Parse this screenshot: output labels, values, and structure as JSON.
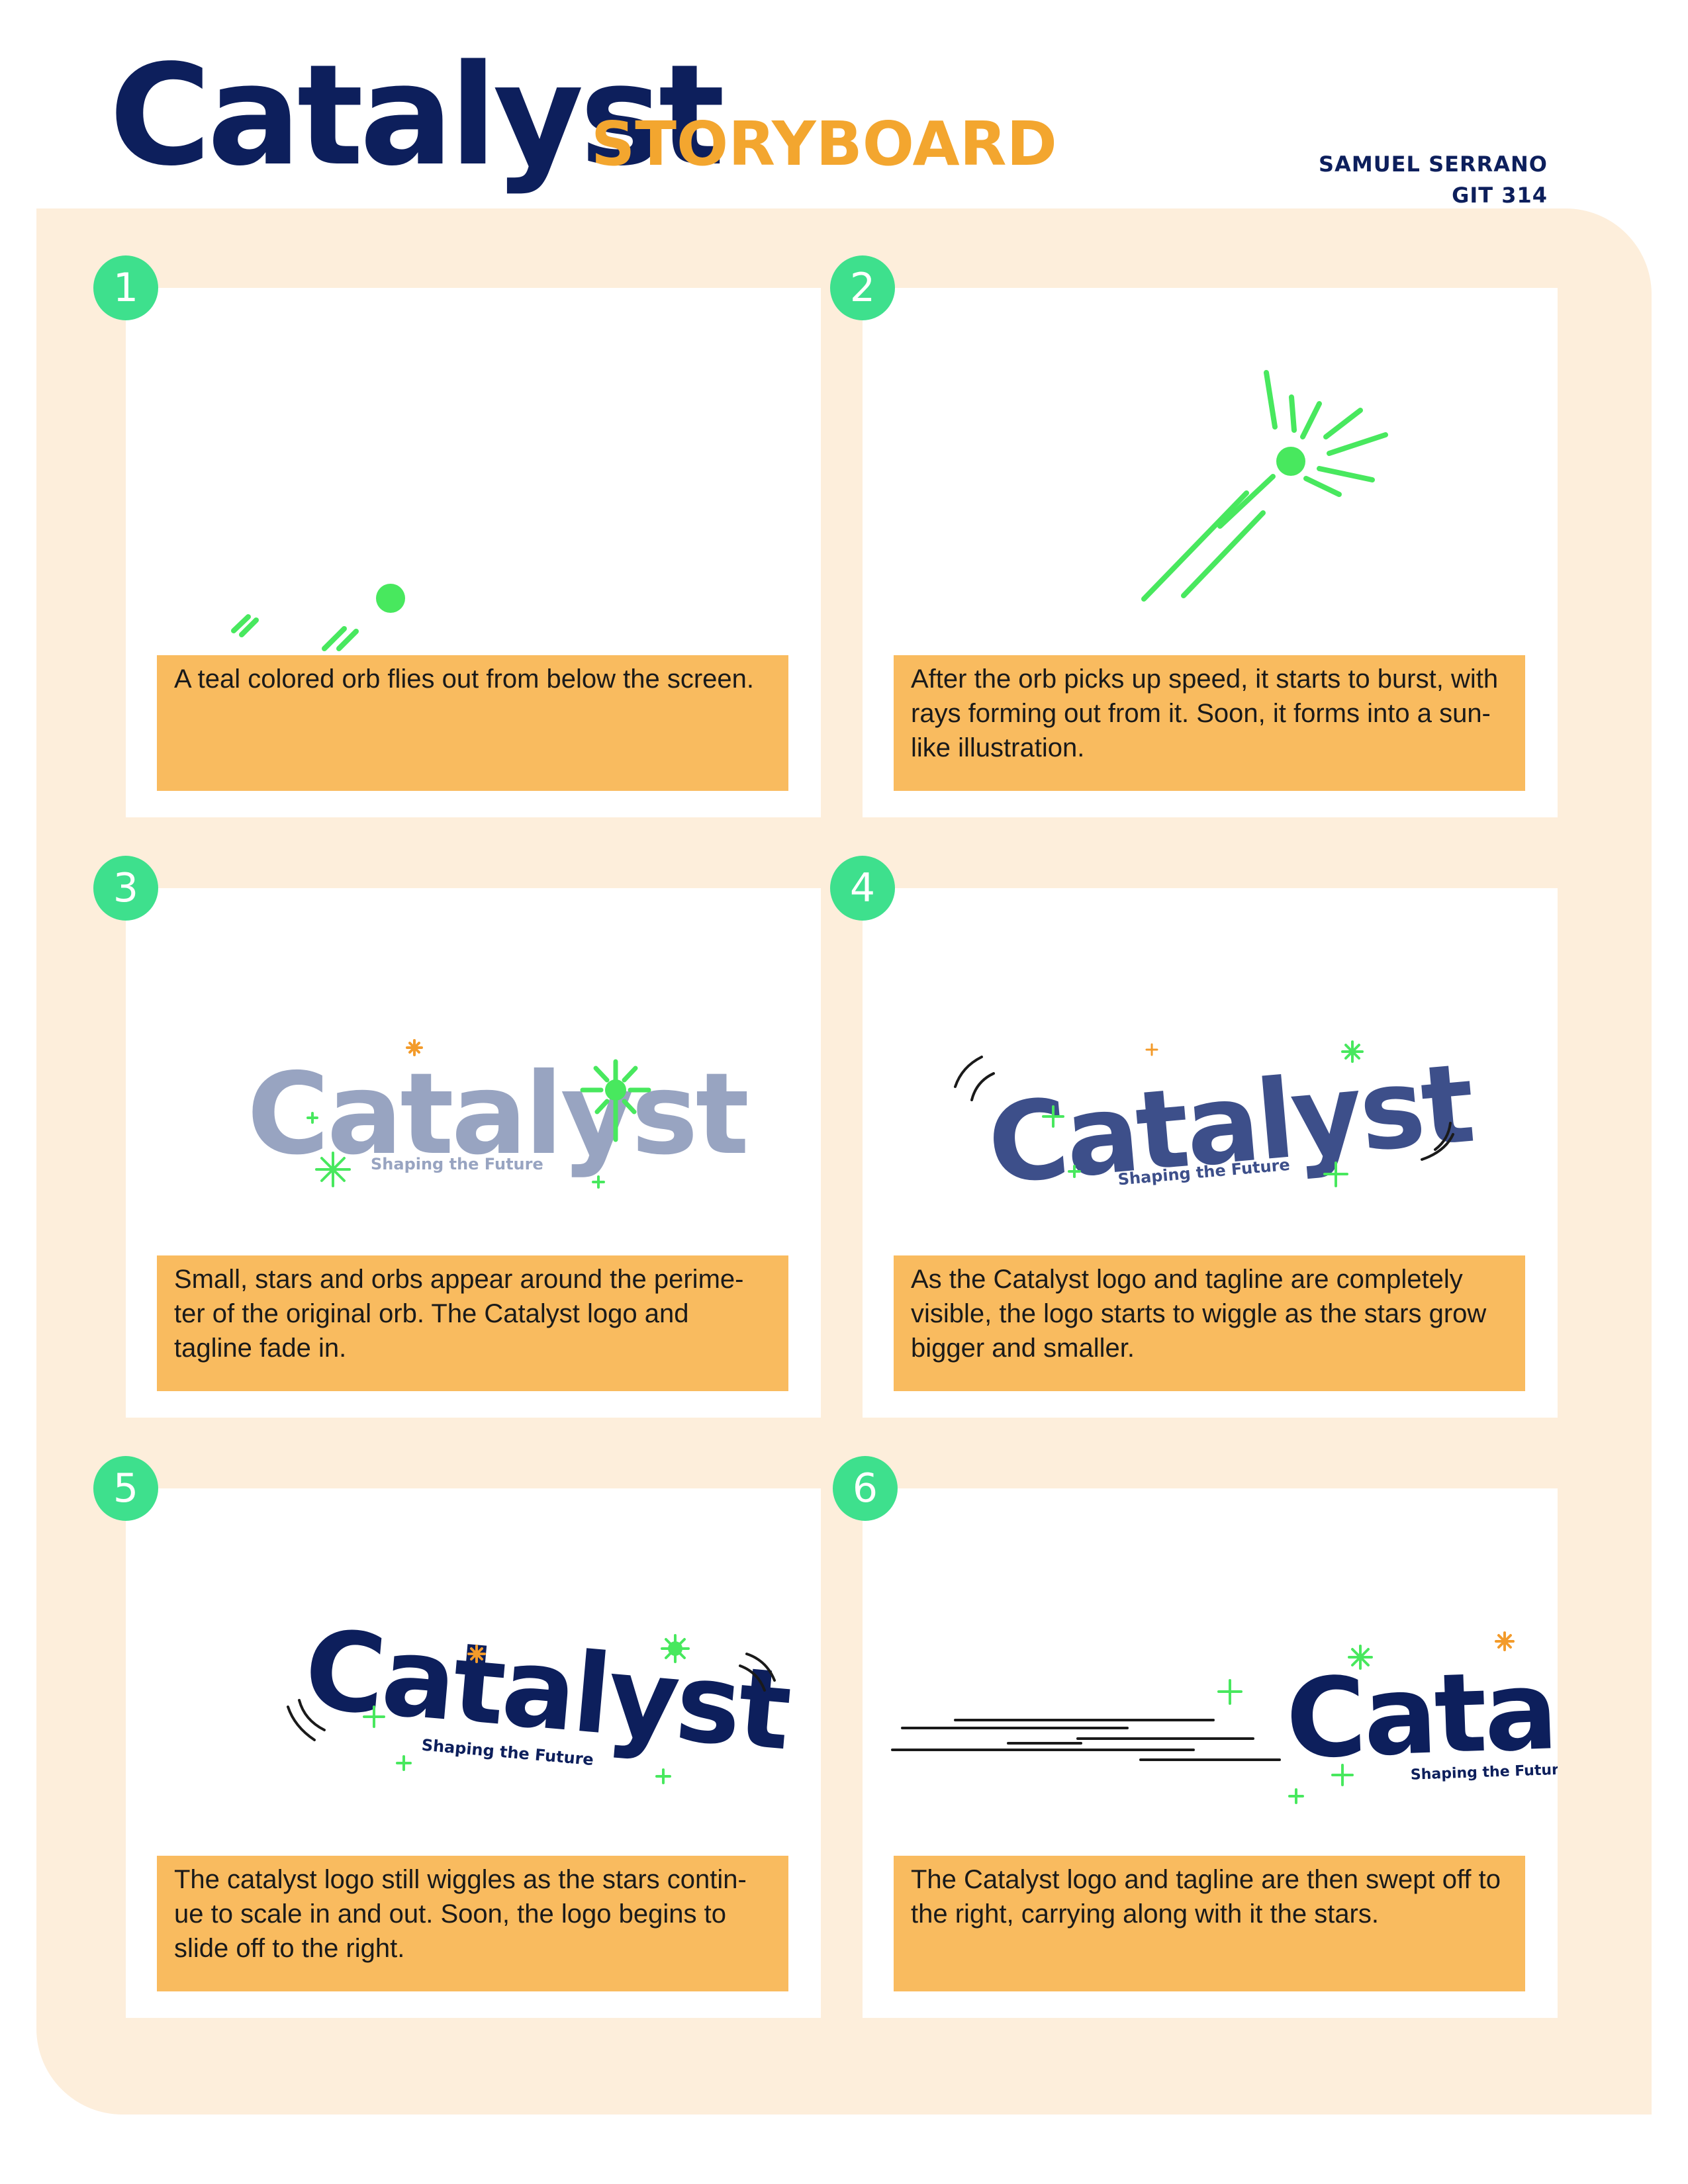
{
  "header": {
    "title": "Catalyst",
    "subtitle": "STORYBOARD",
    "author": "SAMUEL SERRANO",
    "course": "GIT 314"
  },
  "colors": {
    "navy": "#0d1f5c",
    "navy_mid": "#3d4f8a",
    "navy_faded": "#98a4c1",
    "gold": "#f3a62f",
    "board_bg": "#fdeedb",
    "caption_bg": "#f9bb5f",
    "badge_green": "#3ee08d",
    "orb_green": "#48e85e",
    "star_orange": "#f39b2b"
  },
  "logo": {
    "word": "Catalyst",
    "partial_word": "Catal",
    "tagline": "Shaping the Future"
  },
  "panels": [
    {
      "number": "1",
      "caption": "A teal colored orb flies out from below the screen."
    },
    {
      "number": "2",
      "caption": "After the orb picks up speed, it starts to burst, with rays forming out from it. Soon, it forms into a sun-like illustration."
    },
    {
      "number": "3",
      "caption": "Small, stars and orbs appear around the perime-ter of the original orb. The Catalyst logo and tagline fade in."
    },
    {
      "number": "4",
      "caption": "As the Catalyst logo and tagline are completely visible, the logo starts to wiggle as the stars grow bigger and smaller."
    },
    {
      "number": "5",
      "caption": "The catalyst logo still wiggles as the stars contin-ue to scale in and out. Soon, the logo begins to slide off to the right."
    },
    {
      "number": "6",
      "caption": "The Catalyst logo and tagline are then swept off to the right, carrying along with it the stars."
    }
  ]
}
